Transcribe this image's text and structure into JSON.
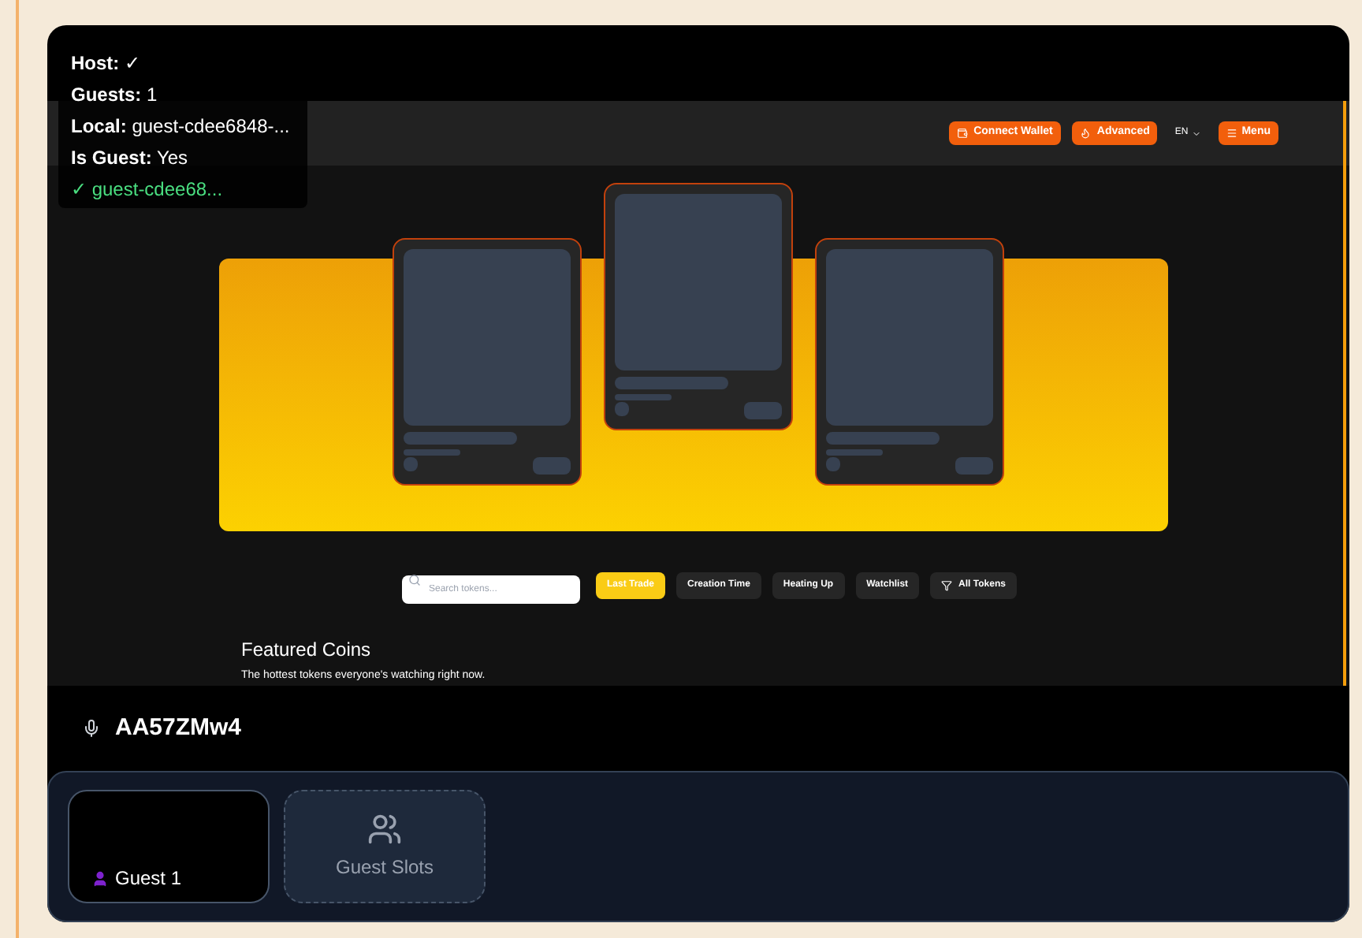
{
  "overlay": {
    "lines": [
      {
        "label": "Host:",
        "value": "✓"
      },
      {
        "label": "Guests:",
        "value": "1"
      },
      {
        "label": "Local:",
        "value": "guest-cdee6848-..."
      },
      {
        "label": "Is Guest:",
        "value": "Yes"
      }
    ],
    "status": "✓ guest-cdee68..."
  },
  "site": {
    "nav_buttons": [
      {
        "label": "Connect Wallet",
        "kind": "wallet"
      },
      {
        "label": "Advanced",
        "kind": "advanced"
      }
    ],
    "language": "EN",
    "menu": "Menu",
    "search_placeholder": "Search tokens...",
    "filters": [
      {
        "label": "Last Trade",
        "selected": true,
        "kind": "plain"
      },
      {
        "label": "Creation Time",
        "selected": false,
        "kind": "plain"
      },
      {
        "label": "Heating Up",
        "selected": false,
        "kind": "plain"
      },
      {
        "label": "Watchlist",
        "selected": false,
        "kind": "plain"
      },
      {
        "label": "All Tokens",
        "selected": false,
        "kind": "icon"
      }
    ],
    "section_title": "Featured Coins",
    "section_subtitle": "The hottest tokens everyone's watching right now."
  },
  "stream": {
    "name": "AA57ZMw4"
  },
  "guests": [
    {
      "name": "Guest 1"
    }
  ],
  "guest_slots": "Guest Slots"
}
